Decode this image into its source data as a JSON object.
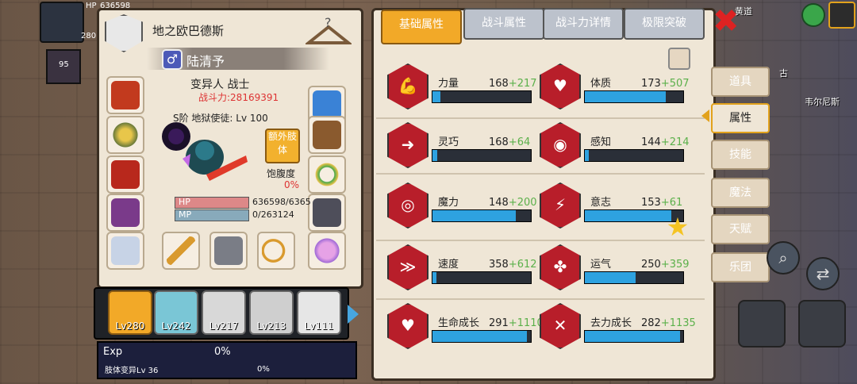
{
  "hud": {
    "hp_label": "HP",
    "hp_value": "636598",
    "level": "280",
    "mini_level": "95"
  },
  "character": {
    "title": "地之欧巴德斯",
    "name": "陆清予",
    "gender_symbol": "♂",
    "class": "变异人 战士",
    "power": "战斗力:28169391",
    "rank": "S阶 地狱使徒: Lv 100",
    "extra_limb_button": "额外肢体",
    "satiety_label": "饱腹度",
    "satiety_value": "0%",
    "hp_label": "HP",
    "hp_value": "636598/6365",
    "mp_label": "MP",
    "mp_value": "0/263124",
    "help_symbol": "?"
  },
  "party": [
    {
      "level": "Lv280",
      "selected": true
    },
    {
      "level": "Lv242",
      "selected": false
    },
    {
      "level": "Lv217",
      "selected": false
    },
    {
      "level": "Lv213",
      "selected": false
    },
    {
      "level": "Lv111",
      "selected": false
    }
  ],
  "exp": {
    "label": "Exp",
    "percent": "0%",
    "sub_label": "肢体变异Lv 36",
    "sub_percent": "0%"
  },
  "tabs": [
    "基础属性",
    "战斗属性",
    "战斗力详情",
    "极限突破"
  ],
  "close_symbol": "✖",
  "stats": [
    {
      "label": "力量",
      "base": "168",
      "bonus": "+217",
      "fill": 0.08,
      "icon": "muscle-icon"
    },
    {
      "label": "体质",
      "base": "173",
      "bonus": "+507",
      "fill": 0.82,
      "icon": "body-icon"
    },
    {
      "label": "灵巧",
      "base": "168",
      "bonus": "+64",
      "fill": 0.05,
      "icon": "running-icon"
    },
    {
      "label": "感知",
      "base": "144",
      "bonus": "+214",
      "fill": 0.04,
      "icon": "eye-icon"
    },
    {
      "label": "魔力",
      "base": "148",
      "bonus": "+200",
      "fill": 0.85,
      "icon": "swirl-icon"
    },
    {
      "label": "意志",
      "base": "153",
      "bonus": "+61",
      "fill": 0.88,
      "icon": "will-icon"
    },
    {
      "label": "速度",
      "base": "358",
      "bonus": "+612",
      "fill": 0.04,
      "icon": "speed-icon"
    },
    {
      "label": "运气",
      "base": "250",
      "bonus": "+359",
      "fill": 0.52,
      "icon": "clover-icon"
    },
    {
      "label": "生命成长",
      "base": "291",
      "bonus": "+1110",
      "fill": 0.96,
      "icon": "heart-icon"
    },
    {
      "label": "去力成长",
      "base": "282",
      "bonus": "+1135",
      "fill": 0.97,
      "icon": "skull-icon"
    }
  ],
  "side_tabs": [
    "道具",
    "属性",
    "技能",
    "魔法",
    "天赋",
    "乐团"
  ],
  "map_labels": {
    "town": "韦尔尼斯",
    "a": "古",
    "b": "黄道"
  },
  "colors": {
    "accent": "#f2a928",
    "stat_badge": "#b81e2a",
    "bar_fill": "#2ea2e0",
    "bonus": "#5bb04a",
    "power": "#dd3333"
  }
}
